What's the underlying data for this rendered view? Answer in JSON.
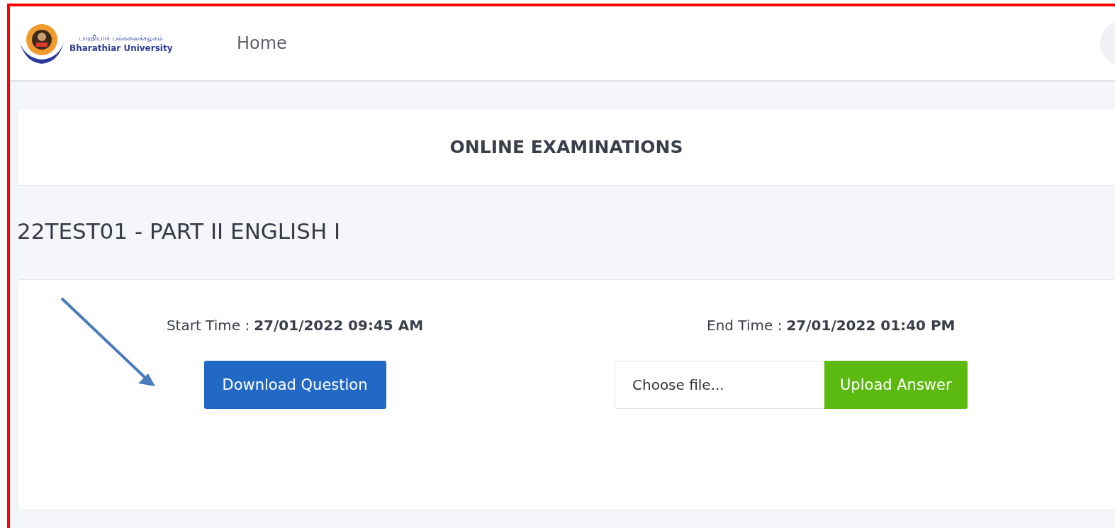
{
  "header": {
    "logo": {
      "tamil_name": "பாரதியார் பல்கலைக்கழகம்",
      "name": "Bharathiar University"
    },
    "nav": [
      {
        "label": "Home"
      }
    ]
  },
  "banner": {
    "title": "ONLINE EXAMINATIONS"
  },
  "course": {
    "title": "22TEST01 - PART II ENGLISH I"
  },
  "exam": {
    "start": {
      "label": "Start Time :",
      "value": "27/01/2022 09:45 AM"
    },
    "end": {
      "label": "End Time :",
      "value": "27/01/2022 01:40 PM"
    },
    "download_button": "Download Question",
    "file": {
      "placeholder": "Choose file..."
    },
    "upload_button": "Upload Answer"
  }
}
